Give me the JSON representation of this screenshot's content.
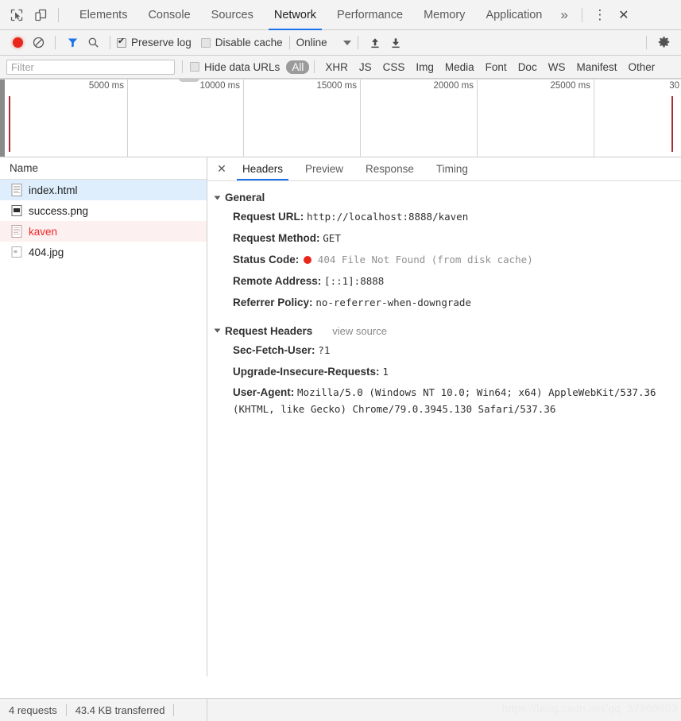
{
  "devtools": {
    "icons": {
      "inspect": "inspect-element-icon",
      "device": "device-toolbar-icon",
      "more_panels": "»",
      "menu": "⋮",
      "close": "✕"
    },
    "panel_tabs": [
      {
        "label": "Elements",
        "active": false
      },
      {
        "label": "Console",
        "active": false
      },
      {
        "label": "Sources",
        "active": false
      },
      {
        "label": "Network",
        "active": true
      },
      {
        "label": "Performance",
        "active": false
      },
      {
        "label": "Memory",
        "active": false
      },
      {
        "label": "Application",
        "active": false
      }
    ]
  },
  "toolbar": {
    "record_title": "record-button",
    "clear_title": "clear-button",
    "filter_title": "filter-toggle",
    "search_title": "search-button",
    "preserve_log": {
      "label": "Preserve log",
      "checked": true
    },
    "disable_cache": {
      "label": "Disable cache",
      "checked": false
    },
    "throttling": {
      "value": "Online"
    },
    "import_har": "import-har-icon",
    "export_har": "export-har-icon",
    "settings": "settings-gear-icon"
  },
  "filterbar": {
    "input_value": "",
    "input_placeholder": "Filter",
    "hide_data_urls": {
      "label": "Hide data URLs",
      "checked": false
    },
    "types": [
      {
        "label": "All",
        "selected": true
      },
      {
        "label": "XHR",
        "selected": false
      },
      {
        "label": "JS",
        "selected": false
      },
      {
        "label": "CSS",
        "selected": false
      },
      {
        "label": "Img",
        "selected": false
      },
      {
        "label": "Media",
        "selected": false
      },
      {
        "label": "Font",
        "selected": false
      },
      {
        "label": "Doc",
        "selected": false
      },
      {
        "label": "WS",
        "selected": false
      },
      {
        "label": "Manifest",
        "selected": false
      },
      {
        "label": "Other",
        "selected": false
      }
    ]
  },
  "overview": {
    "ticks": [
      "5000 ms",
      "10000 ms",
      "15000 ms",
      "20000 ms",
      "25000 ms",
      "30"
    ],
    "event_line_color": "#b02836"
  },
  "requests": {
    "column_header": "Name",
    "rows": [
      {
        "name": "index.html",
        "icon": "document-icon",
        "state": "selected"
      },
      {
        "name": "success.png",
        "icon": "image-icon",
        "state": "normal"
      },
      {
        "name": "kaven",
        "icon": "document-icon",
        "state": "failed"
      },
      {
        "name": "404.jpg",
        "icon": "broken-image-icon",
        "state": "normal"
      }
    ]
  },
  "details": {
    "close_label": "✕",
    "tabs": [
      {
        "label": "Headers",
        "active": true
      },
      {
        "label": "Preview",
        "active": false
      },
      {
        "label": "Response",
        "active": false
      },
      {
        "label": "Timing",
        "active": false
      }
    ],
    "general": {
      "title": "General",
      "rows": [
        {
          "key": "Request URL:",
          "value": "http://localhost:8888/kaven",
          "dim": false
        },
        {
          "key": "Request Method:",
          "value": "GET",
          "dim": false
        },
        {
          "key": "Status Code:",
          "value": "404 File Not Found (from disk cache)",
          "dim": true,
          "status_dot": true
        },
        {
          "key": "Remote Address:",
          "value": "[::1]:8888",
          "dim": false
        },
        {
          "key": "Referrer Policy:",
          "value": "no-referrer-when-downgrade",
          "dim": false
        }
      ]
    },
    "request_headers": {
      "title": "Request Headers",
      "view_source": "view source",
      "rows": [
        {
          "key": "Sec-Fetch-User:",
          "value": "?1"
        },
        {
          "key": "Upgrade-Insecure-Requests:",
          "value": "1"
        },
        {
          "key": "User-Agent:",
          "value": "Mozilla/5.0 (Windows NT 10.0; Win64; x64) AppleWebKit/537.36 (KHTML, like Gecko) Chrome/79.0.3945.130 Safari/537.36"
        }
      ]
    }
  },
  "footer": {
    "requests_count": "4 requests",
    "transferred": "43.4 KB transferred",
    "watermark": "https://blog.csdn.net/qq_37960603"
  }
}
